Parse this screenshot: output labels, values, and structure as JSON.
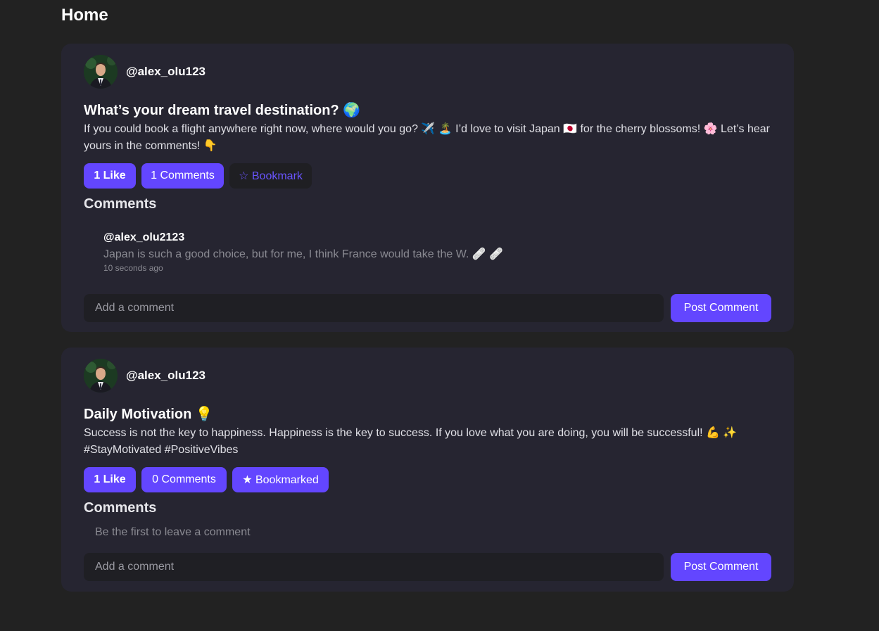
{
  "page": {
    "title": "Home"
  },
  "posts": [
    {
      "author": "@alex_olu123",
      "title": "What’s your dream travel destination? 🌍",
      "body": "If you could book a flight anywhere right now, where would you go? ✈️ 🏝️ I’d love to visit Japan 🇯🇵 for the cherry blossoms! 🌸 Let’s hear yours in the comments! 👇",
      "like_label": "1 Like",
      "comments_label": "1 Comments",
      "bookmark_label": "☆ Bookmark",
      "comments_heading": "Comments",
      "comments": [
        {
          "author": "@alex_olu2123",
          "text": "Japan is such a good choice, but for me, I think France would take the W. 🩹 🩹",
          "time": "10 seconds ago"
        }
      ],
      "comment_placeholder": "Add a comment",
      "post_comment_label": "Post Comment"
    },
    {
      "author": "@alex_olu123",
      "title": "Daily Motivation 💡",
      "body": "Success is not the key to happiness. Happiness is the key to success. If you love what you are doing, you will be successful! 💪 ✨ #StayMotivated #PositiveVibes",
      "like_label": "1 Like",
      "comments_label": "0 Comments",
      "bookmark_label": "★ Bookmarked",
      "comments_heading": "Comments",
      "empty_comments": "Be the first to leave a comment",
      "comment_placeholder": "Add a comment",
      "post_comment_label": "Post Comment"
    }
  ],
  "colors": {
    "background": "#222222",
    "card": "#262531",
    "accent": "#6346ff",
    "muted_text": "#8a8a92"
  },
  "icons": {
    "avatar": "user-avatar-photo"
  }
}
